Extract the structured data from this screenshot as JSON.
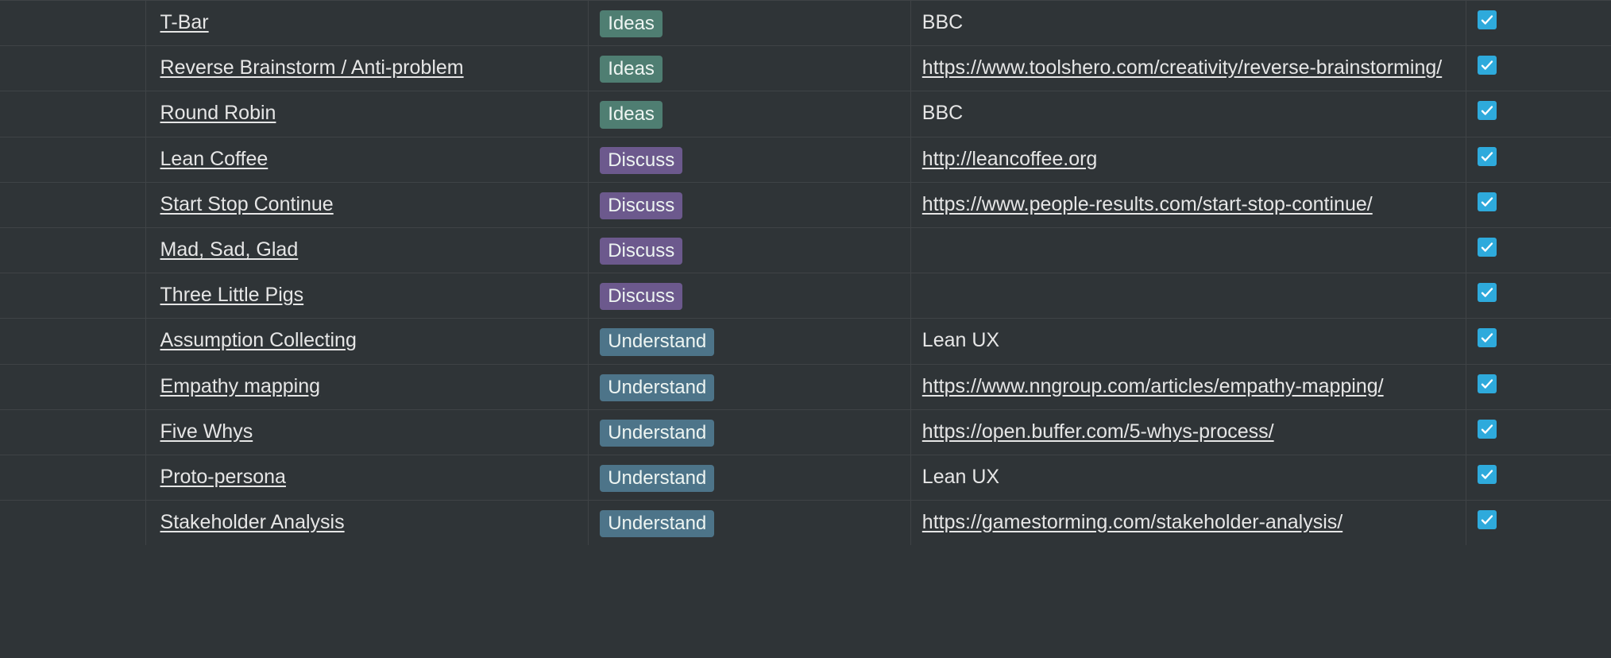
{
  "tags": {
    "ideas": {
      "label": "Ideas",
      "class": "tag-ideas"
    },
    "discuss": {
      "label": "Discuss",
      "class": "tag-discuss"
    },
    "understand": {
      "label": "Understand",
      "class": "tag-understand"
    }
  },
  "rows": [
    {
      "name": "T-Bar",
      "tag": "ideas",
      "source_text": "BBC",
      "source_is_link": false,
      "checked": true
    },
    {
      "name": "Reverse Brainstorm / Anti-problem",
      "tag": "ideas",
      "source_text": "https://www.toolshero.com/creativity/reverse-brainstorming/",
      "source_is_link": true,
      "checked": true
    },
    {
      "name": "Round Robin",
      "tag": "ideas",
      "source_text": "BBC",
      "source_is_link": false,
      "checked": true
    },
    {
      "name": "Lean Coffee",
      "tag": "discuss",
      "source_text": "http://leancoffee.org",
      "source_is_link": true,
      "checked": true
    },
    {
      "name": "Start Stop Continue",
      "tag": "discuss",
      "source_text": "https://www.people-results.com/start-stop-continue/",
      "source_is_link": true,
      "checked": true
    },
    {
      "name": "Mad, Sad, Glad",
      "tag": "discuss",
      "source_text": "",
      "source_is_link": false,
      "checked": true
    },
    {
      "name": "Three Little Pigs",
      "tag": "discuss",
      "source_text": "",
      "source_is_link": false,
      "checked": true
    },
    {
      "name": "Assumption Collecting",
      "tag": "understand",
      "source_text": "Lean UX",
      "source_is_link": false,
      "checked": true
    },
    {
      "name": "Empathy mapping",
      "tag": "understand",
      "source_text": "https://www.nngroup.com/articles/empathy-mapping/",
      "source_is_link": true,
      "checked": true
    },
    {
      "name": "Five Whys",
      "tag": "understand",
      "source_text": "https://open.buffer.com/5-whys-process/",
      "source_is_link": true,
      "checked": true
    },
    {
      "name": "Proto-persona",
      "tag": "understand",
      "source_text": "Lean UX",
      "source_is_link": false,
      "checked": true
    },
    {
      "name": "Stakeholder Analysis",
      "tag": "understand",
      "source_text": "https://gamestorming.com/stakeholder-analysis/",
      "source_is_link": true,
      "checked": true
    }
  ]
}
